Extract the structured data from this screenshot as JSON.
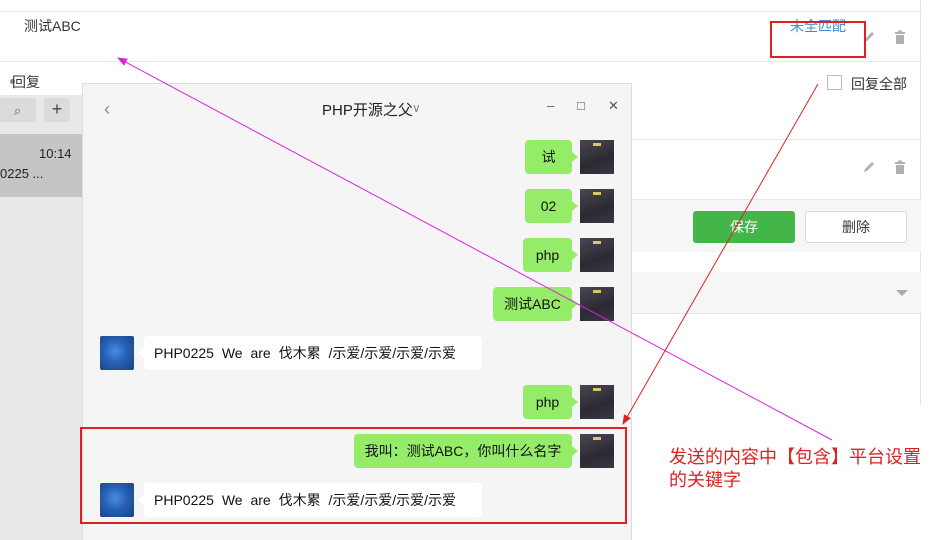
{
  "admin": {
    "keyword_text": "测试ABC",
    "match_mode": "未全匹配",
    "reply_label": "回复",
    "reply_all_label": "回复全部",
    "save_label": "保存",
    "delete_label": "删除"
  },
  "chat": {
    "title": "PHP开源之父",
    "sidebar": {
      "plus": "+",
      "conversation_time": "10:14",
      "conversation_preview": "0225 ..."
    },
    "messages": [
      {
        "from": "me",
        "text": "试"
      },
      {
        "from": "me",
        "text": "02"
      },
      {
        "from": "me",
        "text": "php"
      },
      {
        "from": "me",
        "text": "测试ABC"
      },
      {
        "from": "other",
        "text": "PHP0225  We  are  伐木累  /示爱/示爱/示爱/示爱"
      },
      {
        "from": "me",
        "text": "php"
      },
      {
        "from": "me",
        "text": "我叫：测试ABC，你叫什么名字"
      },
      {
        "from": "other",
        "text": "PHP0225  We  are  伐木累  /示爱/示爱/示爱/示爱"
      }
    ]
  },
  "annotation": {
    "line1": "发送的内容中【包含】平台设置",
    "line2": "的关键字",
    "color": "#e02020",
    "arrow_color_keyword": "#e020e0"
  },
  "colors": {
    "bubble_me": "#95ec69",
    "save_button": "#44b549",
    "link": "#3f8ed3"
  }
}
